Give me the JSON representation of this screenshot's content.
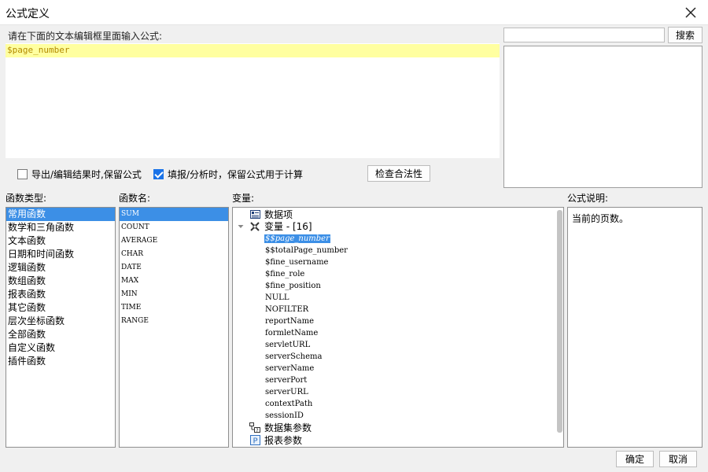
{
  "window": {
    "title": "公式定义"
  },
  "editor": {
    "instruction": "请在下面的文本编辑框里面输入公式:",
    "formula": "$page_number"
  },
  "search": {
    "button_label": "搜索",
    "placeholder": ""
  },
  "options": {
    "export_keep_formula": {
      "label": "导出/编辑结果时,保留公式",
      "checked": false
    },
    "fill_keep_formula": {
      "label": "填报/分析时，保留公式用于计算",
      "checked": true
    },
    "check_button": "检查合法性"
  },
  "function_types": {
    "label": "函数类型:",
    "items": [
      "常用函数",
      "数学和三角函数",
      "文本函数",
      "日期和时间函数",
      "逻辑函数",
      "数组函数",
      "报表函数",
      "其它函数",
      "层次坐标函数",
      "全部函数",
      "自定义函数",
      "插件函数"
    ],
    "selected": 0
  },
  "function_names": {
    "label": "函数名:",
    "items": [
      "SUM",
      "COUNT",
      "AVERAGE",
      "CHAR",
      "DATE",
      "MAX",
      "MIN",
      "TIME",
      "RANGE"
    ],
    "selected": 0
  },
  "variables": {
    "label": "变量:",
    "data_item": "数据项",
    "var_group": "变量 - [16]",
    "var_items": [
      "$$page_number",
      "$$totalPage_number",
      "$fine_username",
      "$fine_role",
      "$fine_position",
      "NULL",
      "NOFILTER",
      "reportName",
      "formletName",
      "servletURL",
      "serverSchema",
      "serverName",
      "serverPort",
      "serverURL",
      "contextPath",
      "sessionID"
    ],
    "selected_var": 0,
    "dataset_params": "数据集参数",
    "report_params": "报表参数"
  },
  "description": {
    "label": "公式说明:",
    "text": "当前的页数。"
  },
  "buttons": {
    "ok": "确定",
    "cancel": "取消"
  },
  "colors": {
    "selection": "#3c8fe6",
    "editor_highlight": "#ffffa0",
    "formula_text": "#b38a00"
  },
  "icons": {
    "close": "close-icon",
    "data_item": "list-icon",
    "var_group": "variable-icon",
    "expand": "chevron-down-icon",
    "dataset": "dataset-param-icon",
    "report": "report-param-icon"
  }
}
